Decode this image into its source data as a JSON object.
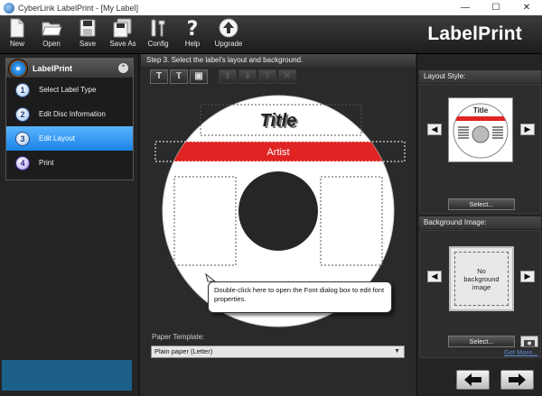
{
  "window": {
    "title": "CyberLink LabelPrint - [My Label]",
    "controls": [
      "—",
      "☐",
      "✕"
    ]
  },
  "toolbar": {
    "buttons": [
      {
        "label": "New"
      },
      {
        "label": "Open"
      },
      {
        "label": "Save"
      },
      {
        "label": "Save As"
      },
      {
        "label": "Config"
      },
      {
        "label": "Help"
      },
      {
        "label": "Upgrade"
      }
    ],
    "brand": "LabelPrint"
  },
  "wizard": {
    "title": "LabelPrint",
    "collapse_icon": "collapse-up-icon",
    "steps": [
      {
        "num": "1",
        "label": "Select Label Type"
      },
      {
        "num": "2",
        "label": "Edit Disc Information"
      },
      {
        "num": "3",
        "label": "Edit Layout"
      },
      {
        "num": "4",
        "label": "Print"
      }
    ],
    "active_step": 3
  },
  "main": {
    "step_title": "Step 3. Select the label's layout and background.",
    "tools": [
      {
        "icon": "text-tool-icon",
        "glyph": "T",
        "enabled": true
      },
      {
        "icon": "curved-text-tool-icon",
        "glyph": "Ⲧ",
        "enabled": true
      },
      {
        "icon": "image-tool-icon",
        "glyph": "▣",
        "enabled": true
      },
      {
        "icon": "bring-forward-icon",
        "glyph": "⬆",
        "enabled": false
      },
      {
        "icon": "send-backward-icon",
        "glyph": "⬇",
        "enabled": false
      },
      {
        "icon": "rotate-text-icon",
        "glyph": "T",
        "enabled": false
      },
      {
        "icon": "delete-icon",
        "glyph": "✕",
        "enabled": false
      }
    ],
    "disc": {
      "title_text": "Title",
      "artist_text": "Artist",
      "tooltip": "Double-click here to open the Font dialog box to edit font properties."
    },
    "paper_template_label": "Paper Template:",
    "paper_template_value": "Plain paper (Letter)"
  },
  "right": {
    "layout_style_title": "Layout Style:",
    "background_title": "Background Image:",
    "thumb_title": "Title",
    "select_label": "Select...",
    "no_background_text": "No background image",
    "get_more": "Get More..."
  },
  "colors": {
    "accent_red": "#e02424",
    "active_blue": "#2b90f0"
  }
}
